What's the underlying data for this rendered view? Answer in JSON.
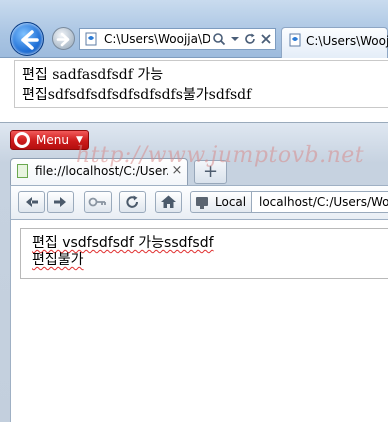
{
  "ie": {
    "address_text": "C:\\Users\\Woojja\\De",
    "tab_title": "C:\\Users\\Woojja\\",
    "content": {
      "line1_word1": "편집",
      "line1_word2": "sadfasdfsdf",
      "line1_word3": "가능",
      "line2": "편집sdfsdfsdfsdfsdfsdfs불가sdfsdf"
    }
  },
  "watermark": "http://www.jumptovb.net",
  "opera": {
    "menu_label": "Menu",
    "tab_title": "file://localhost/C:/User...",
    "tab_close": "×",
    "new_tab": "+",
    "local_label": "Local",
    "url_text": "localhost/C:/Users/Wooj",
    "content": {
      "line1": "편집 vsdfsdfsdf 가능ssdfsdf",
      "line2": "편집불가"
    }
  },
  "icons": {
    "ie_back": "arrow-left-icon",
    "ie_forward": "arrow-right-icon",
    "ie_search": "search-icon",
    "ie_dropdown": "chevron-down-icon",
    "ie_refresh": "refresh-icon",
    "ie_stop": "close-icon",
    "opera_back": "arrow-left-icon",
    "opera_forward": "arrow-right-icon",
    "opera_key": "key-icon",
    "opera_reload": "reload-icon",
    "opera_home": "home-icon",
    "opera_local": "monitor-icon"
  },
  "colors": {
    "opera_red": "#cc1b1b",
    "ie_blue": "#1f6fd6",
    "spellcheck": "#e03030"
  }
}
